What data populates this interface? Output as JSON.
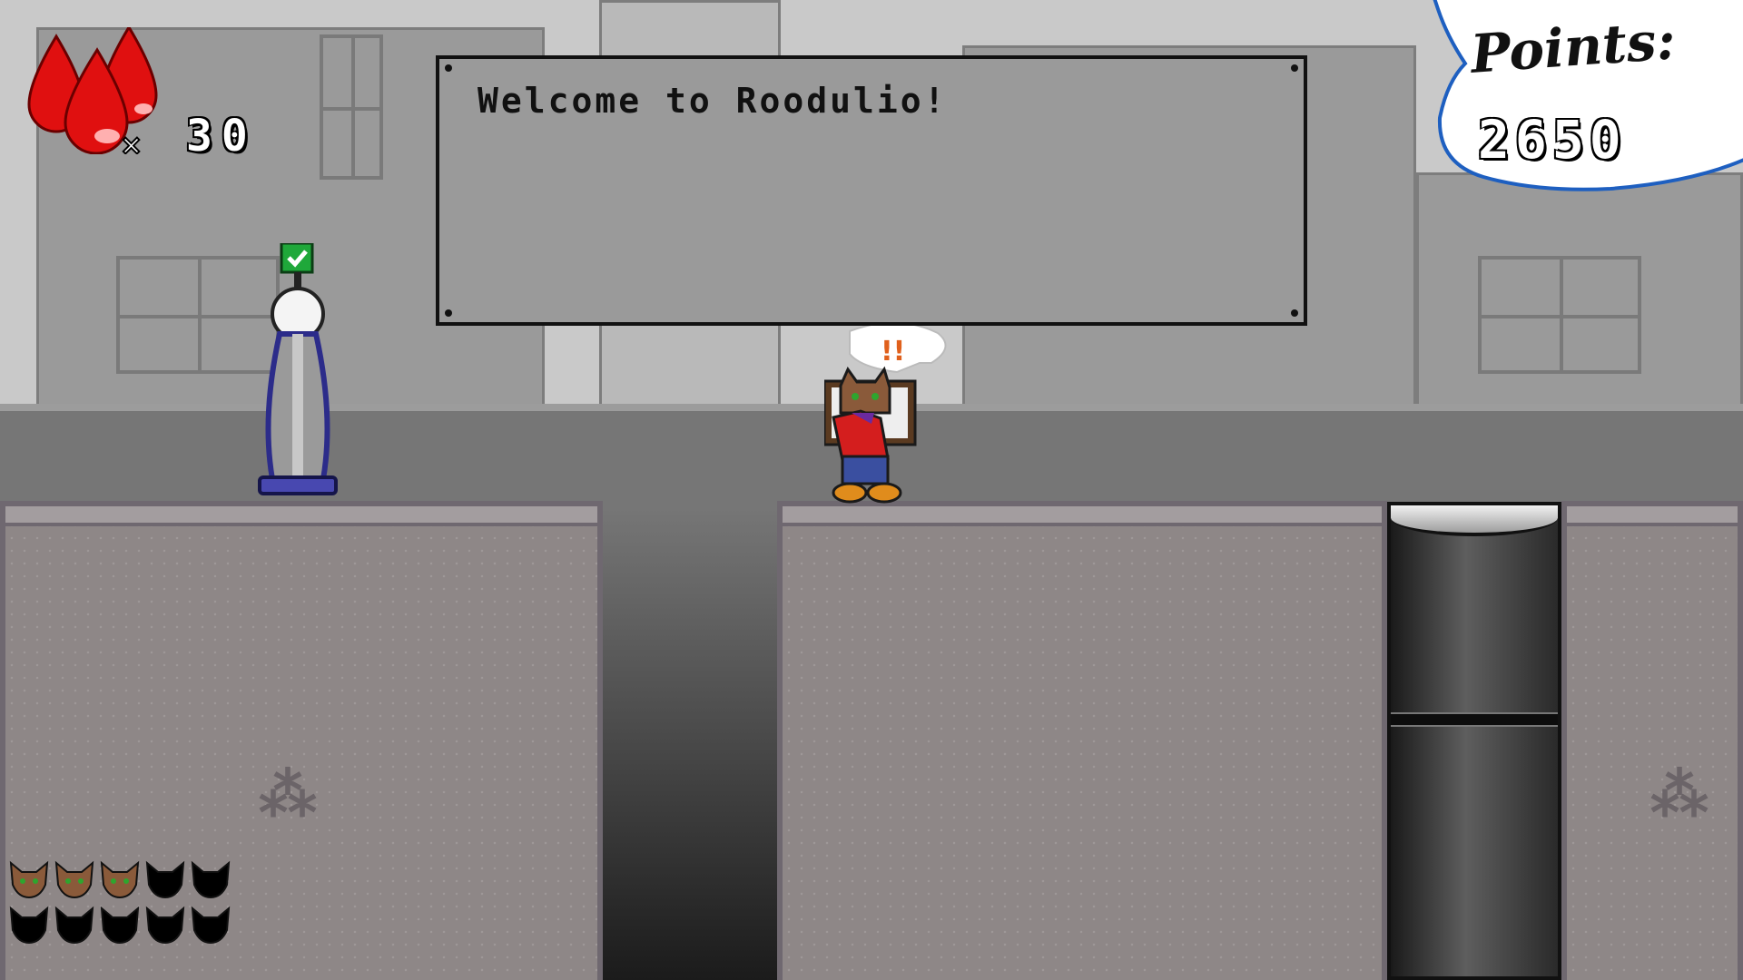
{
  "hud": {
    "blood_count": "30",
    "blood_multiplier": "×",
    "points_label": "Points:",
    "points_value": "2650"
  },
  "dialog": {
    "message": "Welcome to Roodulio!"
  },
  "player": {
    "speech_bubble": "!!"
  },
  "lives": {
    "total": 10,
    "remaining": 3
  },
  "colors": {
    "blood": "#e01010",
    "checkpoint_flag": "#1fa83a",
    "checkpoint_pole": "#2c2c8a",
    "player_cape": "#d41e1e",
    "player_fur": "#8a5a3a"
  },
  "icons": [
    "blood-drop-icon",
    "checkmark-icon",
    "cat-head-icon",
    "speech-bubble-icon"
  ]
}
